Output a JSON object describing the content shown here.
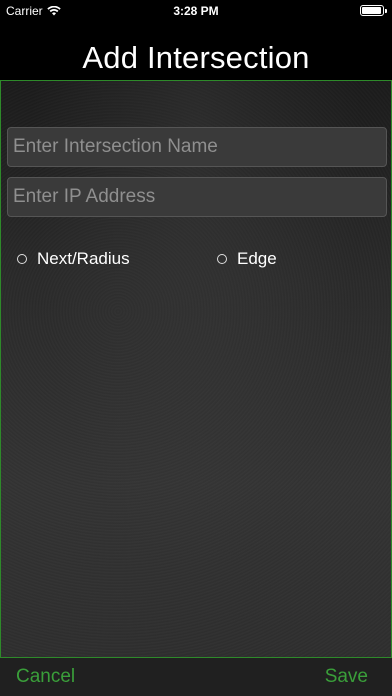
{
  "status_bar": {
    "carrier": "Carrier",
    "time": "3:28 PM"
  },
  "header": {
    "title": "Add Intersection"
  },
  "form": {
    "name_placeholder": "Enter Intersection Name",
    "name_value": "",
    "ip_placeholder": "Enter IP Address",
    "ip_value": "",
    "radio_options": [
      {
        "label": "Next/Radius",
        "selected": false
      },
      {
        "label": "Edge",
        "selected": false
      }
    ]
  },
  "toolbar": {
    "cancel_label": "Cancel",
    "save_label": "Save",
    "accent_color": "#3a9f3a"
  },
  "colors": {
    "border": "#2e8a2a",
    "background": "#000000"
  }
}
